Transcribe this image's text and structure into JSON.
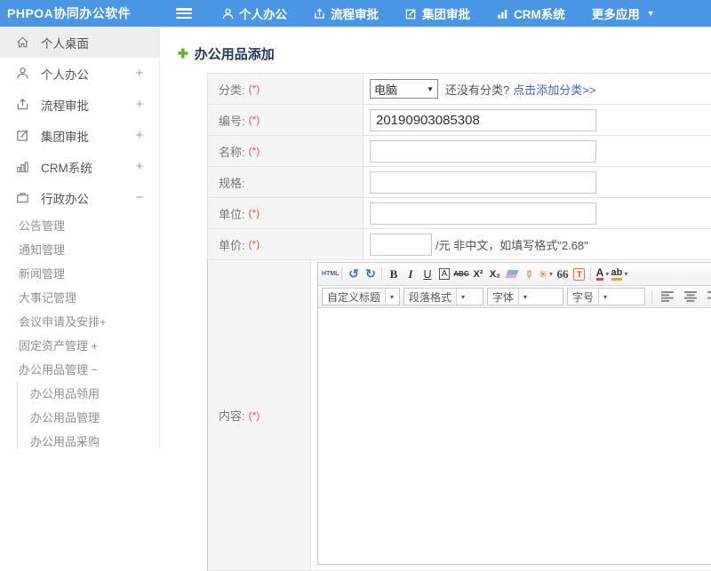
{
  "header": {
    "logo": "PHPOA协同办公软件",
    "nav": {
      "personal": "个人办公",
      "workflow": "流程审批",
      "group": "集团审批",
      "crm": "CRM系统",
      "more": "更多应用",
      "more_caret": "▼"
    }
  },
  "sidebar": {
    "items": [
      {
        "label": "个人桌面",
        "expander": ""
      },
      {
        "label": "个人办公",
        "expander": "+"
      },
      {
        "label": "流程审批",
        "expander": "+"
      },
      {
        "label": "集团审批",
        "expander": "+"
      },
      {
        "label": "CRM系统",
        "expander": "+"
      },
      {
        "label": "行政办公",
        "expander": "−"
      }
    ],
    "admin_children": [
      {
        "label": "公告管理"
      },
      {
        "label": "通知管理"
      },
      {
        "label": "新闻管理"
      },
      {
        "label": "大事记管理"
      },
      {
        "label": "会议申请及安排+"
      },
      {
        "label": "固定资产管理 +"
      },
      {
        "label": "办公用品管理 −"
      }
    ],
    "supplies_children": [
      {
        "label": "办公用品领用"
      },
      {
        "label": "办公用品管理"
      },
      {
        "label": "办公用品采购"
      }
    ]
  },
  "main": {
    "title": "办公用品添加",
    "plus_glyph": "✚",
    "form": {
      "category": {
        "label": "分类:",
        "required": "(*)",
        "value": "电脑",
        "caret": "▼",
        "hint": "还没有分类?",
        "link": "点击添加分类>>"
      },
      "code": {
        "label": "编号:",
        "required": "(*)",
        "value": "20190903085308"
      },
      "name": {
        "label": "名称:",
        "required": "(*)",
        "value": ""
      },
      "spec": {
        "label": "规格:",
        "required": "",
        "value": ""
      },
      "unit": {
        "label": "单位:",
        "required": "(*)",
        "value": ""
      },
      "price": {
        "label": "单价:",
        "required": "(*)",
        "value": "",
        "suffix": "/元 非中文，如填写格式\"2.68\""
      },
      "content": {
        "label": "内容:",
        "required": "(*)"
      }
    },
    "editor": {
      "toolbar1": {
        "html": "HTML",
        "undo": "↺",
        "redo": "↻",
        "bold": "B",
        "italic": "I",
        "underline": "U",
        "fontborder": "A",
        "strike": "ABC",
        "sup": "X²",
        "sub": "X₂",
        "brush": "✏",
        "magic": "✳",
        "quote": "66",
        "paste": "T",
        "fontcolor": "A",
        "highlight": "ab",
        "caret": "▾"
      },
      "toolbar2": {
        "heading": "自定义标题",
        "paragraph": "段落格式",
        "font": "字体",
        "size": "字号",
        "caret": "▾",
        "link": "∞"
      }
    }
  },
  "colors": {
    "header_blue": "#4b96e4",
    "link_blue": "#3f66cc",
    "required_red": "#e9594c",
    "title_navy": "#24395b",
    "plus_green": "#5cb427",
    "content_row_border": "#a9cfe0",
    "label_cell_bg": "#f5f5f5"
  }
}
